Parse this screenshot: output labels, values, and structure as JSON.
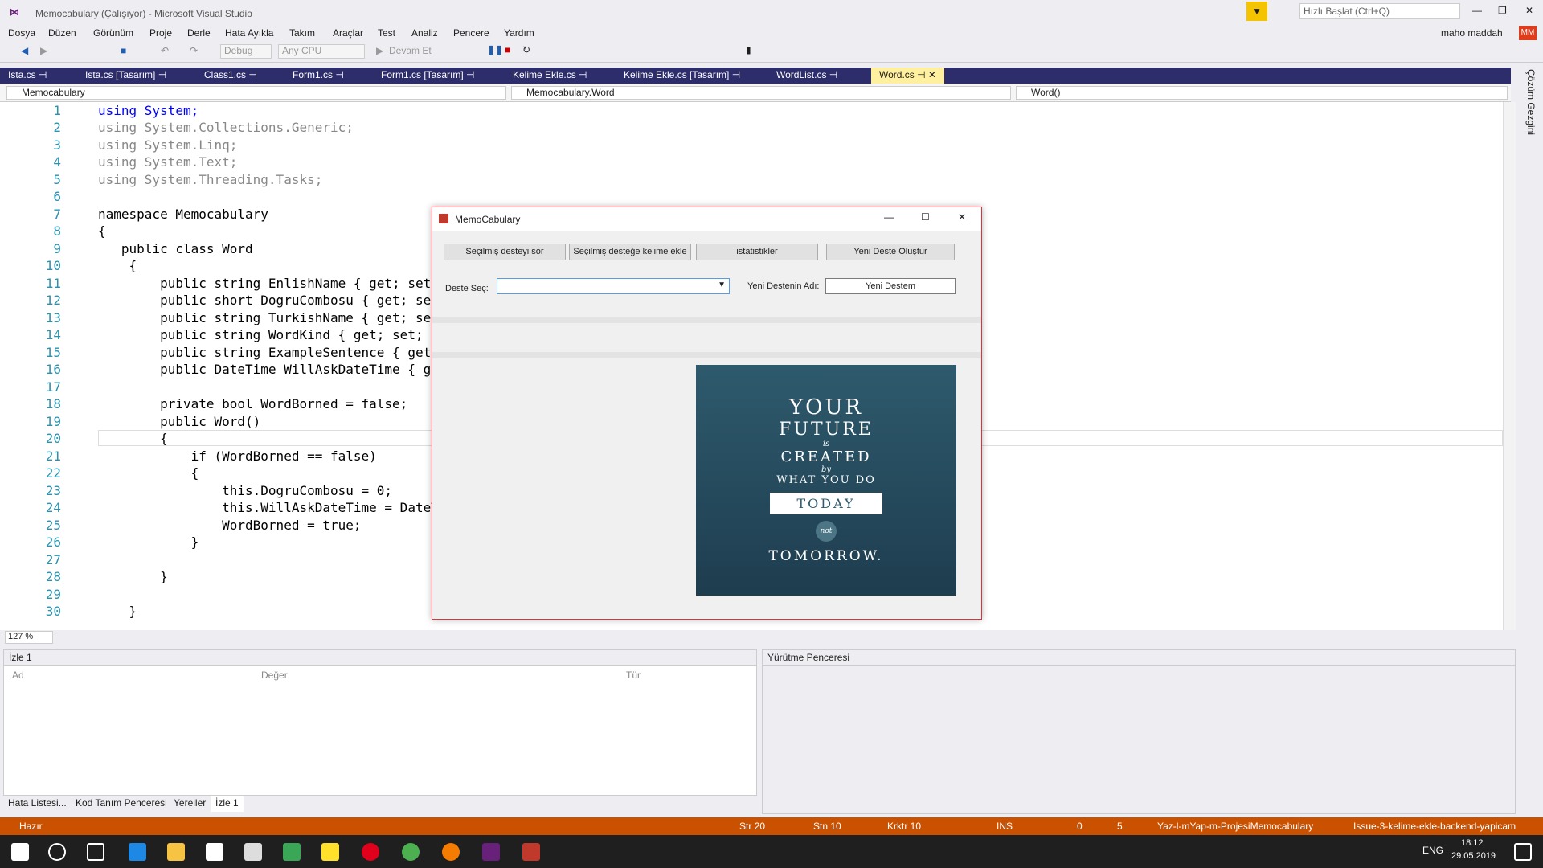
{
  "titlebar": {
    "title": "Memocabulary (Çalışıyor) - Microsoft Visual Studio",
    "quick_launch": "Hızlı Başlat (Ctrl+Q)",
    "user": "maho maddah",
    "user_initials": "MM"
  },
  "menu": [
    "Dosya",
    "Düzen",
    "Görünüm",
    "Proje",
    "Derle",
    "Hata Ayıkla",
    "Takım",
    "Araçlar",
    "Test",
    "Analiz",
    "Pencere",
    "Yardım"
  ],
  "toolbar": {
    "config": "Debug",
    "platform": "Any CPU",
    "continue_label": "Devam Et"
  },
  "tabs": [
    "Ista.cs",
    "Ista.cs [Tasarım]",
    "Class1.cs",
    "Form1.cs",
    "Form1.cs [Tasarım]",
    "Kelime Ekle.cs",
    "Kelime Ekle.cs [Tasarım]",
    "WordList.cs",
    "Word.cs"
  ],
  "nav": {
    "project": "Memocabulary",
    "class": "Memocabulary.Word",
    "member": "Word()"
  },
  "sidebar_label": "Çözüm Gezgini",
  "code": {
    "line_numbers": [
      "1",
      "2",
      "3",
      "4",
      "5",
      "6",
      "7",
      "8",
      "9",
      "10",
      "11",
      "12",
      "13",
      "14",
      "15",
      "16",
      "17",
      "18",
      "19",
      "20",
      "21",
      "22",
      "23",
      "24",
      "25",
      "26",
      "27",
      "28",
      "29",
      "30"
    ],
    "lines": [
      "using System;",
      "using System.Collections.Generic;",
      "using System.Linq;",
      "using System.Text;",
      "using System.Threading.Tasks;",
      "",
      "namespace Memocabulary",
      "{",
      "   public class Word",
      "    {",
      "        public string EnlishName { get; set; }",
      "        public short DogruCombosu { get; set;",
      "        public string TurkishName { get; set;",
      "        public string WordKind { get; set; }//",
      "        public string ExampleSentence { get; s",
      "        public DateTime WillAskDateTime { get;",
      "",
      "        private bool WordBorned = false;",
      "        public Word()",
      "        {",
      "            if (WordBorned == false)",
      "            {",
      "                this.DogruCombosu = 0;",
      "                this.WillAskDateTime = DateTim",
      "                WordBorned = true;",
      "            }",
      "",
      "        }",
      "",
      "    }"
    ]
  },
  "zoom": "127 %",
  "watch": {
    "title": "İzle 1",
    "col_name": "Ad",
    "col_value": "Değer",
    "col_type": "Tür"
  },
  "exec_title": "Yürütme Penceresi",
  "bottom_tabs": [
    "Hata Listesi...",
    "Kod Tanım Penceresi",
    "Yereller",
    "İzle 1"
  ],
  "status": {
    "ready": "Hazır",
    "row": "Str 20",
    "col": "Stn 10",
    "char": "Krktr 10",
    "ins": "INS",
    "up": "0",
    "edit": "5",
    "repo": "Yaz-l-mYap-m-ProjesiMemocabulary",
    "branch": "Issue-3-kelime-ekle-backend-yapicam"
  },
  "clock": {
    "time": "18:12",
    "date": "29.05.2019",
    "lang": "ENG"
  },
  "form": {
    "title": "MemoCabulary",
    "buttons": [
      "Seçilmiş desteyi sor",
      "Seçilmiş desteğe kelime ekle",
      "istatistikler",
      "Yeni Deste Oluştur"
    ],
    "deck_label": "Deste Seç:",
    "new_deck_label": "Yeni Destenin Adı:",
    "new_deck_value": "Yeni Destem",
    "poster": [
      "YOUR",
      "FUTURE",
      "is",
      "CREATED",
      "by",
      "WHAT YOU DO",
      "TODAY",
      "not",
      "TOMORROW."
    ]
  }
}
